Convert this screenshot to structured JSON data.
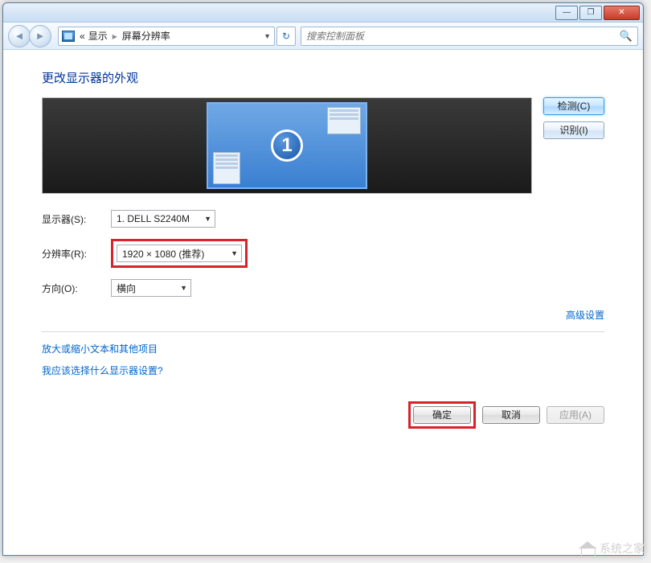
{
  "titlebar": {
    "min": "—",
    "max": "❐",
    "close": "✕"
  },
  "nav": {
    "back": "◄",
    "fwd": "►",
    "crumb_prefix": "«",
    "crumb1": "显示",
    "crumb2": "屏幕分辨率",
    "drop": "▼",
    "refresh": "↻",
    "search_placeholder": "搜索控制面板",
    "search_icon": "🔍"
  },
  "page": {
    "title": "更改显示器的外观",
    "monitor_number": "1",
    "detect": "检测(C)",
    "identify": "识别(I)",
    "labels": {
      "display": "显示器(S):",
      "resolution": "分辨率(R):",
      "orientation": "方向(O):"
    },
    "values": {
      "display": "1. DELL S2240M",
      "resolution": "1920 × 1080 (推荐)",
      "orientation": "横向"
    },
    "dd_arrow": "▼",
    "advanced": "高级设置",
    "link1": "放大或缩小文本和其他项目",
    "link2": "我应该选择什么显示器设置?",
    "buttons": {
      "ok": "确定",
      "cancel": "取消",
      "apply": "应用(A)"
    }
  },
  "watermark": "系统之家"
}
